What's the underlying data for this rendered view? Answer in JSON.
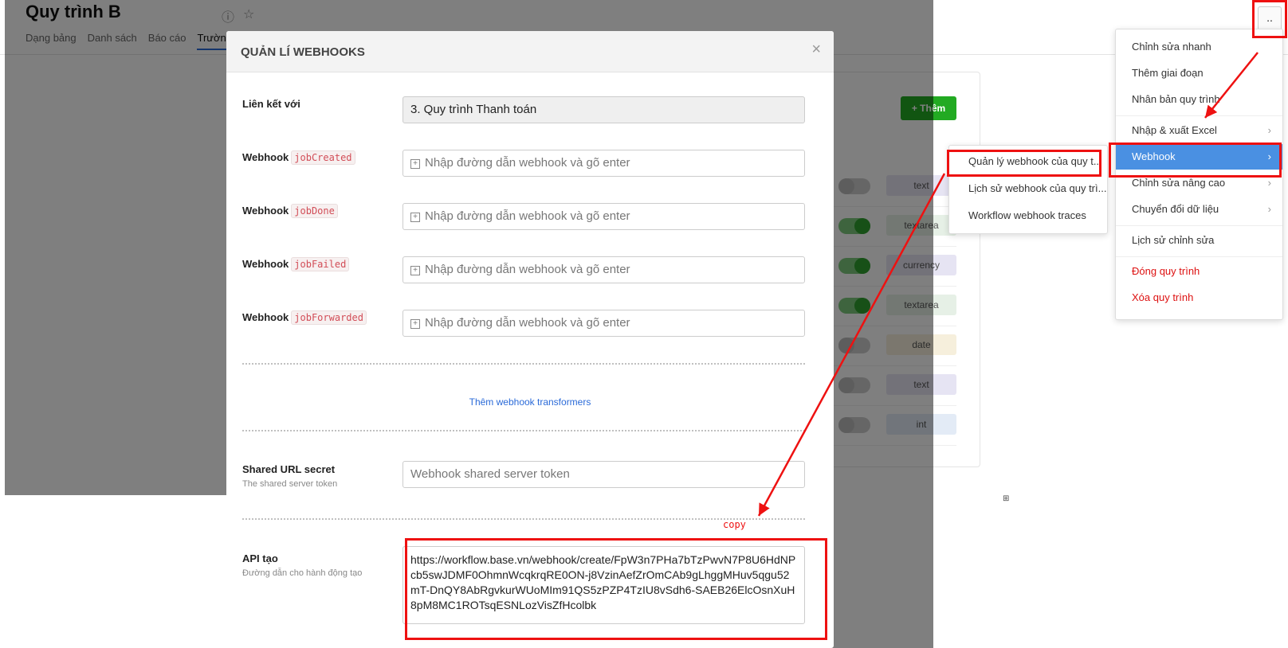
{
  "page": {
    "title": "Quy trình B",
    "tabs": [
      "Dạng bảng",
      "Danh sách",
      "Báo cáo",
      "Trường"
    ],
    "more_button": "..",
    "add_button": "+ Thêm",
    "fields": [
      {
        "type": "text",
        "on": false,
        "color": "#e6e4f3"
      },
      {
        "type": "textarea",
        "on": true,
        "color": "#e6f0e6"
      },
      {
        "type": "currency",
        "on": true,
        "color": "#e6e4f3"
      },
      {
        "type": "textarea",
        "on": true,
        "color": "#e6f0e6"
      },
      {
        "type": "date",
        "on": false,
        "color": "#f6efdc"
      },
      {
        "type": "text",
        "on": false,
        "color": "#e6e4f3"
      },
      {
        "type": "int",
        "on": false,
        "color": "#e3ebf6"
      }
    ]
  },
  "modal": {
    "title": "QUẢN LÍ WEBHOOKS",
    "close": "×",
    "link_label": "Liên kết với",
    "link_value": "3. Quy trình Thanh toán",
    "webhook_prefix": "Webhook",
    "webhooks": [
      {
        "event": "jobCreated",
        "placeholder": "Nhập đường dẫn webhook và gõ enter"
      },
      {
        "event": "jobDone",
        "placeholder": "Nhập đường dẫn webhook và gõ enter"
      },
      {
        "event": "jobFailed",
        "placeholder": "Nhập đường dẫn webhook và gõ enter"
      },
      {
        "event": "jobForwarded",
        "placeholder": "Nhập đường dẫn webhook và gõ enter"
      }
    ],
    "transformers_link": "Thêm webhook transformers",
    "secret_label": "Shared URL secret",
    "secret_sub": "The shared server token",
    "secret_placeholder": "Webhook shared server token",
    "api_label": "API tạo",
    "api_sub": "Đường dẫn cho hành động tạo",
    "api_value": "https://workflow.base.vn/webhook/create/FpW3n7PHa7bTzPwvN7P8U6HdNPcb5swJDMF0OhmnWcqkrqRE0ON-j8VzinAefZrOmCAb9gLhggMHuv5qgu52mT-DnQY8AbRgvkurWUoMIm91QS5zPZP4TzIU8vSdh6-SAEB26ElcOsnXuH8pM8MC1ROTsqESNLozVisZfHcolbk"
  },
  "menu": {
    "items": [
      {
        "label": "Chỉnh sửa nhanh"
      },
      {
        "label": "Thêm giai đoạn"
      },
      {
        "label": "Nhân bản quy trình"
      },
      {
        "label": "Nhập & xuất Excel",
        "arrow": "›"
      },
      {
        "label": "Webhook",
        "arrow": "›",
        "active": true
      },
      {
        "label": "Chỉnh sửa nâng cao",
        "arrow": "›"
      },
      {
        "label": "Chuyển đổi dữ liệu",
        "arrow": "›"
      },
      {
        "label": "Lịch sử chỉnh sửa"
      },
      {
        "label": "Đóng quy trình",
        "danger": true
      },
      {
        "label": "Xóa quy trình",
        "danger": true
      }
    ],
    "submenu": [
      {
        "label": "Quản lý webhook của quy t..."
      },
      {
        "label": "Lịch sử webhook của quy trì..."
      },
      {
        "label": "Workflow webhook traces"
      }
    ]
  },
  "annotation": {
    "copy_label": "copy",
    "color": "#e11111"
  }
}
